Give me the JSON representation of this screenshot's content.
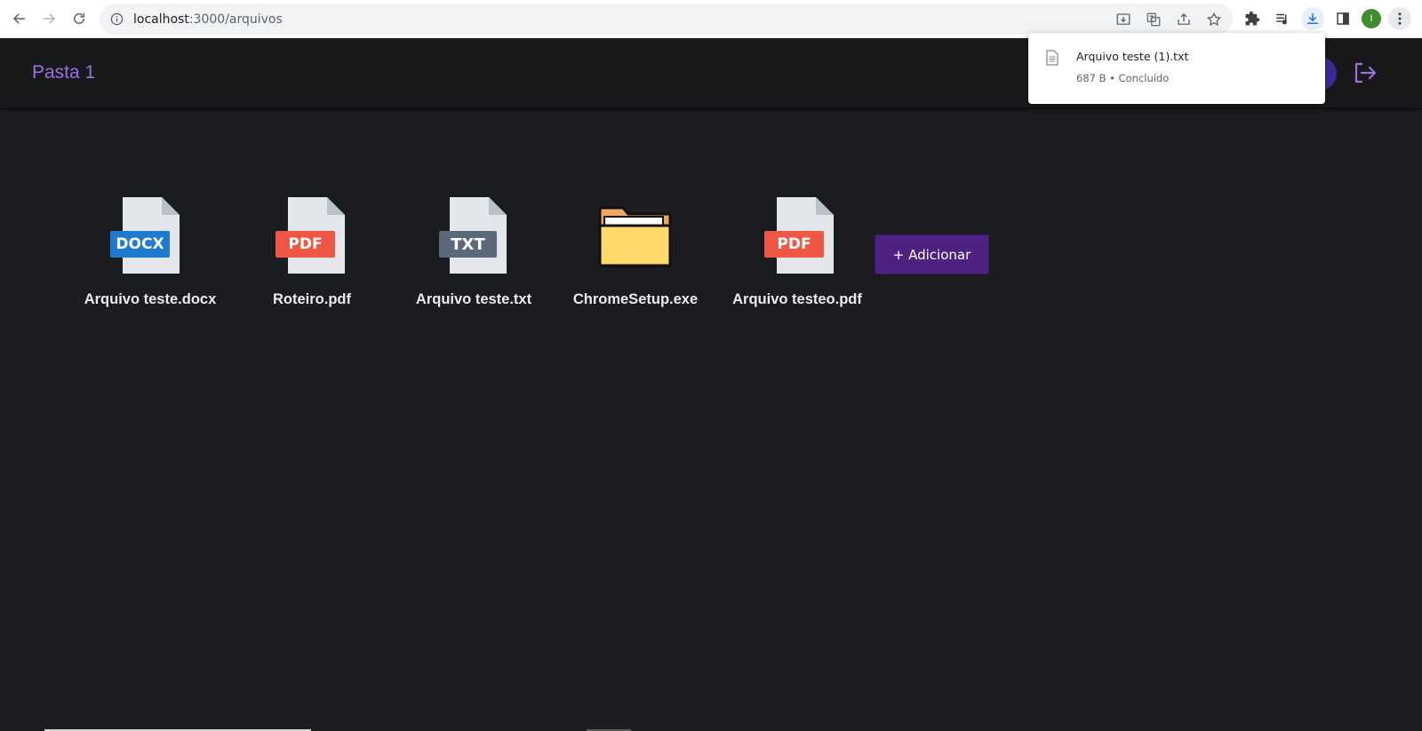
{
  "browser": {
    "url_host": "localhost",
    "url_path": ":3000/arquivos",
    "profile_initial": "I"
  },
  "app": {
    "folder_title": "Pasta 1"
  },
  "download": {
    "file_name": "Arquivo teste (1).txt",
    "status": "687 B • Concluído"
  },
  "files": [
    {
      "name": "Arquivo teste.docx",
      "type": "DOCX",
      "badge_color": "#1e7bd1"
    },
    {
      "name": "Roteiro.pdf",
      "type": "PDF",
      "badge_color": "#ee5744"
    },
    {
      "name": "Arquivo teste.txt",
      "type": "TXT",
      "badge_color": "#5a6a79"
    },
    {
      "name": "ChromeSetup.exe",
      "type": "folder"
    },
    {
      "name": "Arquivo testeo.pdf",
      "type": "PDF",
      "badge_color": "#ee5744"
    }
  ],
  "add_button_label": "+ Adicionar"
}
